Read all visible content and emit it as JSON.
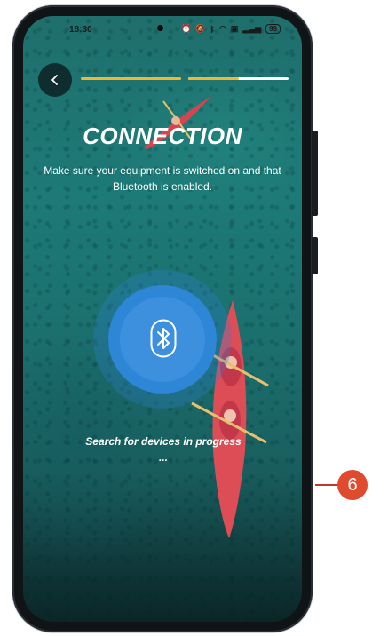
{
  "status_bar": {
    "time": "18:30",
    "icons": [
      "alarm-icon",
      "mute-icon",
      "bluetooth-icon",
      "wifi-icon",
      "data-icon",
      "signal-icon"
    ],
    "battery": "99"
  },
  "progress": {
    "step1_fraction": 1.0,
    "step2_fraction": 0.5
  },
  "header": {
    "back_icon": "chevron-left-icon",
    "title": "CONNECTION",
    "subtitle": "Make sure your equipment is switched on and that Bluetooth is enabled."
  },
  "bluetooth": {
    "icon": "bluetooth-icon",
    "status_text": "Search for devices in progress ..."
  },
  "callout": {
    "number": "6"
  },
  "colors": {
    "accent_yellow": "#f2b632",
    "bluetooth_blue": "#2d86d6",
    "water_teal": "#1d7a77",
    "callout_red": "#e04a2f"
  }
}
